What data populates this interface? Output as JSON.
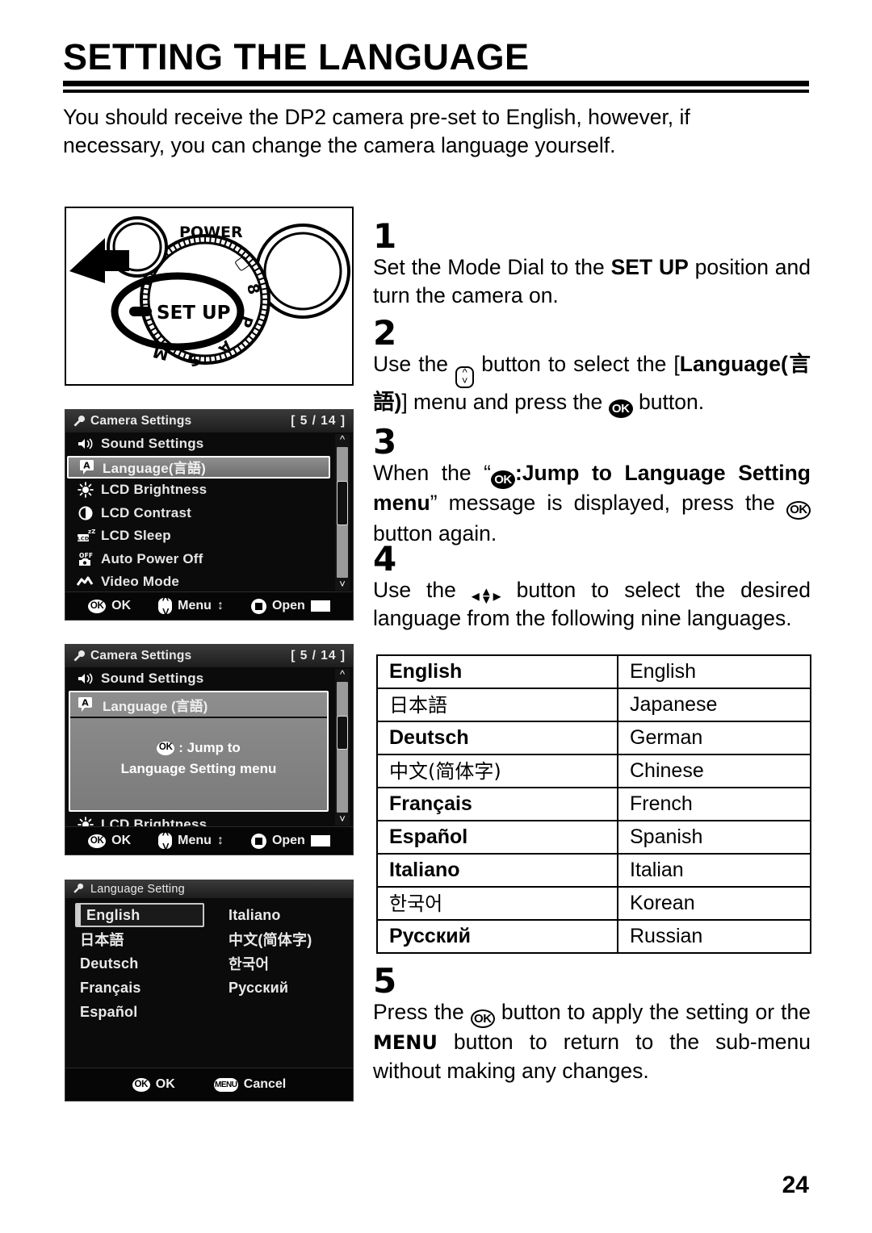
{
  "page": {
    "title": "SETTING THE LANGUAGE",
    "intro_line1": "You should receive the DP2 camera pre-set to English, however, if",
    "intro_line2": "necessary, you can change the camera language yourself.",
    "page_number": "24"
  },
  "figure": {
    "power_label": "POWER",
    "setup_label": "SET UP"
  },
  "steps": [
    {
      "number": "1",
      "text_parts": [
        "Set the Mode Dial to the ",
        "SET UP",
        " position and turn the camera on."
      ]
    },
    {
      "number": "2",
      "text_parts": [
        "Use the ",
        "up-down-button",
        " button to select the [",
        "Language (言語)",
        "] menu and press the ",
        "OK",
        " button."
      ]
    },
    {
      "number": "3",
      "text_parts": [
        "When the “",
        "OK",
        " :Jump to Language Setting menu",
        "” message is displayed, press the ",
        "OK",
        " button again."
      ]
    },
    {
      "number": "4",
      "text_parts": [
        "Use the ",
        "four-way-button",
        " button to select the desired language from the following nine languages."
      ]
    },
    {
      "number": "5",
      "text_parts": [
        "Press the ",
        "OK",
        " button to apply the setting or the ",
        "MENU",
        " button to return to the sub-menu without making any changes."
      ]
    }
  ],
  "step_text": {
    "s1_a": "Set the Mode Dial to the ",
    "s1_b": "SET UP",
    "s1_c": " position and turn the camera on.",
    "s2_a": "Use the ",
    "s2_b": " button to select the [",
    "s2_c": "Language",
    "s2_d": "(言語)",
    "s2_e": "] menu and press the ",
    "s2_f": " button.",
    "s3_a": "When the “",
    "s3_b": ":Jump to Language Setting",
    "s3_c": "menu",
    "s3_d": "” message is displayed, press the ",
    "s3_e": "button again.",
    "s4_a": "Use the ",
    "s4_b": " button to select the desired language from the following nine languages.",
    "s5_a": "Press the ",
    "s5_b": " button to apply the setting or the ",
    "s5_c": "MENU",
    "s5_d": " button to return to the sub-menu without making any changes."
  },
  "lcd1": {
    "title": "Camera Settings",
    "count": "[ 5 / 14 ]",
    "items": [
      {
        "label": "Sound Settings",
        "icon": "speaker-icon",
        "selected": false
      },
      {
        "label": "Language(言語)",
        "icon": "language-a-icon",
        "selected": true
      },
      {
        "label": "LCD Brightness",
        "icon": "brightness-icon",
        "selected": false
      },
      {
        "label": "LCD Contrast",
        "icon": "contrast-icon",
        "selected": false
      },
      {
        "label": "LCD Sleep",
        "icon": "lcd-sleep-icon",
        "selected": false
      },
      {
        "label": "Auto Power Off",
        "icon": "auto-power-off-icon",
        "selected": false
      },
      {
        "label": "Video Mode",
        "icon": "video-mode-icon",
        "selected": false
      }
    ],
    "footer": {
      "ok": "OK",
      "menu": "Menu",
      "open": "Open"
    }
  },
  "lcd2": {
    "title": "Camera Settings",
    "count": "[ 5 / 14 ]",
    "top_item": {
      "label": "Sound Settings",
      "icon": "speaker-icon"
    },
    "popup": {
      "header_label": "Language (言語)",
      "message_line1": ": Jump to",
      "message_line2": "Language Setting menu"
    },
    "bottom_item": {
      "label": "LCD Brightness",
      "icon": "brightness-icon"
    },
    "footer": {
      "ok": "OK",
      "menu": "Menu",
      "open": "Open"
    }
  },
  "lcd3": {
    "title": "Language Setting",
    "left_column": [
      "English",
      "日本語",
      "Deutsch",
      "Français",
      "Español"
    ],
    "right_column": [
      "Italiano",
      "中文(简体字)",
      "한국어",
      "Русский"
    ],
    "selected": "English",
    "footer": {
      "ok": "OK",
      "cancel": "Cancel"
    }
  },
  "language_table": {
    "rows": [
      {
        "native": "English",
        "english": "English",
        "cjk": false
      },
      {
        "native": "日本語",
        "english": "Japanese",
        "cjk": true
      },
      {
        "native": "Deutsch",
        "english": "German",
        "cjk": false
      },
      {
        "native": "中文(简体字)",
        "english": "Chinese",
        "cjk": true
      },
      {
        "native": "Français",
        "english": "French",
        "cjk": false
      },
      {
        "native": "Español",
        "english": "Spanish",
        "cjk": false
      },
      {
        "native": "Italiano",
        "english": "Italian",
        "cjk": false
      },
      {
        "native": "한국어",
        "english": "Korean",
        "cjk": true
      },
      {
        "native": "Русский",
        "english": "Russian",
        "cjk": false
      }
    ]
  },
  "icons": {
    "ok": "OK",
    "menu": "MENU"
  }
}
